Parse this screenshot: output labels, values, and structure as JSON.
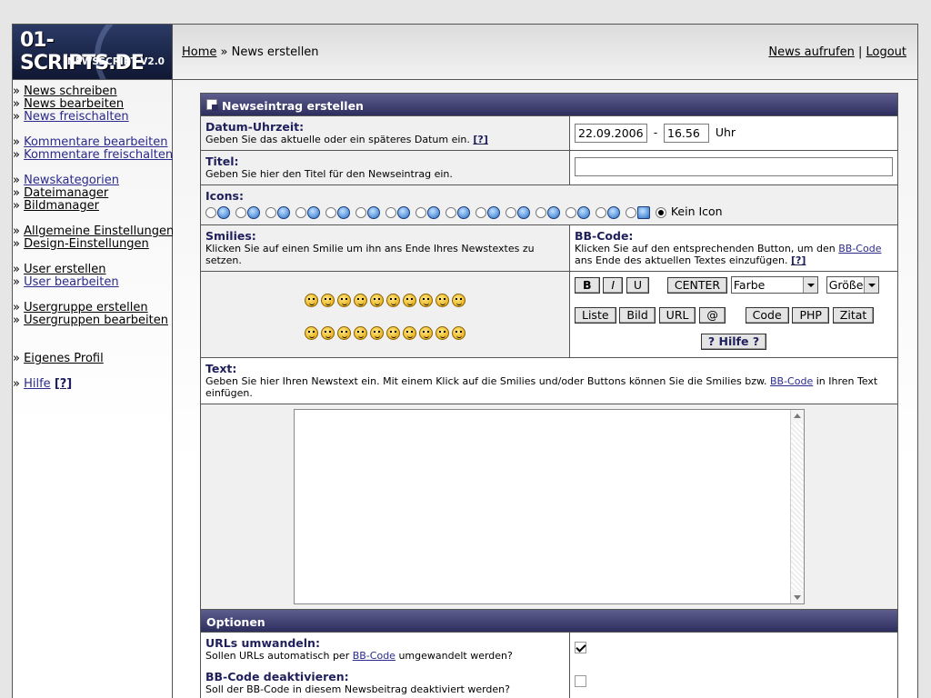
{
  "logo": {
    "title": "01-SCRIPTS.DE",
    "subtitle": "NEWSSCRIPT V2.0"
  },
  "topbar": {
    "home": "Home",
    "sep": " » ",
    "current": "News erstellen",
    "link_view": "News aufrufen",
    "divider": " | ",
    "link_logout": "Logout"
  },
  "sidebar": {
    "group1": [
      "News schreiben",
      "News bearbeiten",
      "News freischalten"
    ],
    "group2": [
      "Kommentare bearbeiten",
      "Kommentare freischalten"
    ],
    "group3": [
      "Newskategorien",
      "Dateimanager",
      "Bildmanager"
    ],
    "group4": [
      "Allgemeine Einstellungen",
      "Design-Einstellungen"
    ],
    "group5": [
      "User erstellen",
      "User bearbeiten"
    ],
    "group6": [
      "Usergruppe erstellen",
      "Usergruppen bearbeiten"
    ],
    "profile": "Eigenes Profil",
    "help": "Hilfe",
    "help_tag": "[?]"
  },
  "form": {
    "header": "Newseintrag erstellen",
    "datetime_label": "Datum-Uhrzeit:",
    "datetime_desc": "Geben Sie das aktuelle oder ein späteres Datum ein.",
    "help_tag": "[?]",
    "date_value": "22.09.2006",
    "dash": "-",
    "time_value": "16.56",
    "time_unit": "Uhr",
    "title_label": "Titel:",
    "title_desc": "Geben Sie hier den Titel für den Newseintrag ein.",
    "title_value": "",
    "icons_label": "Icons:",
    "no_icon": "Kein Icon",
    "smilies_label": "Smilies:",
    "smilies_desc": "Klicken Sie auf einen Smilie um ihn ans Ende Ihres Newstextes zu setzen.",
    "bbcode_label": "BB-Code:",
    "bbcode_desc_1": "Klicken Sie auf den entsprechenden Button, um den ",
    "bbcode_link": "BB-Code",
    "bbcode_desc_2": " ans Ende des aktuellen Textes einzufügen.",
    "buttons": {
      "bold": "B",
      "italic": "I",
      "underline": "U",
      "center": "CENTER",
      "color": "Farbe",
      "size": "Größe",
      "list": "Liste",
      "image": "Bild",
      "url": "URL",
      "at": "@",
      "code": "Code",
      "php": "PHP",
      "quote": "Zitat",
      "help": "? Hilfe ?"
    },
    "text_label": "Text:",
    "text_desc_1": "Geben Sie hier Ihren Newstext ein. Mit einem Klick auf die Smilies und/oder Buttons können Sie die Smilies bzw. ",
    "text_desc_link": "BB-Code",
    "text_desc_2": " in Ihren Text einfügen.",
    "options_header": "Optionen",
    "urls_label": "URLs umwandeln:",
    "urls_desc_1": "Sollen URLs automatisch per ",
    "urls_desc_link": "BB-Code",
    "urls_desc_2": " umgewandelt werden?",
    "urls_checked": true,
    "bbdisable_label": "BB-Code deaktivieren:",
    "bbdisable_desc": "Soll der BB-Code in diesem Newsbeitrag deaktiviert werden?",
    "bbdisable_checked": false
  }
}
